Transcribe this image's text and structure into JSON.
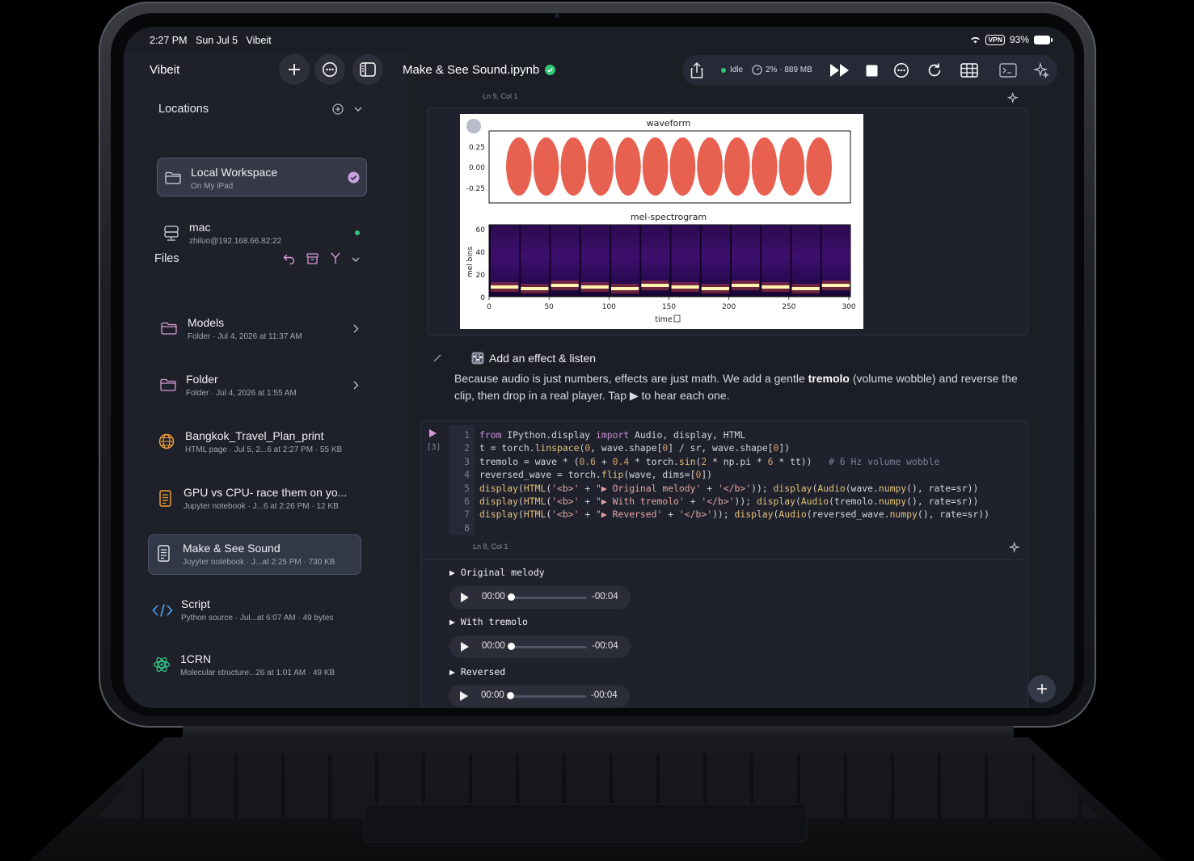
{
  "status_bar": {
    "time": "2:27 PM",
    "date": "Sun Jul 5",
    "app": "Vibeit",
    "vpn": "VPN",
    "battery": "93%"
  },
  "sidebar": {
    "app_name": "Vibeit",
    "locations_header": "Locations",
    "locations": [
      {
        "title": "Local Workspace",
        "subtitle": "On My iPad",
        "icon": "folder-icon",
        "status": "selected"
      },
      {
        "title": "mac",
        "subtitle": "zhiluo@192.168.66.82:22",
        "icon": "server-icon",
        "status": "connected"
      }
    ],
    "files_header": "Files",
    "files": [
      {
        "title": "Models",
        "subtitle": "Folder · Jul 4, 2026 at 11:37 AM",
        "icon": "folder-icon"
      },
      {
        "title": "Folder",
        "subtitle": "Folder · Jul 4, 2026 at 1:55 AM",
        "icon": "folder-icon"
      },
      {
        "title": "Bangkok_Travel_Plan_print",
        "subtitle": "HTML page · Jul 5, 2...6 at 2:27 PM · 55 KB",
        "icon": "globe-icon"
      },
      {
        "title": "GPU vs CPU- race them on yo...",
        "subtitle": "Jupyter notebook · J...6 at 2:26 PM · 12 KB",
        "icon": "notebook-icon"
      },
      {
        "title": "Make & See Sound",
        "subtitle": "Juyyter notebook · J...at 2:25 PM · 730 KB",
        "icon": "notebook-icon"
      },
      {
        "title": "Script",
        "subtitle": "Python source · Jul...at 6:07 AM · 49 bytes",
        "icon": "code-icon"
      },
      {
        "title": "1CRN",
        "subtitle": "Molecular structure...26 at 1:01 AM · 49 KB",
        "icon": "atom-icon"
      }
    ]
  },
  "toolbar": {
    "notebook_title": "Make & See Sound.ipynb",
    "kernel_status": "Idle",
    "resources": "2% · 889 MB"
  },
  "notebook": {
    "cell1_footer": "Ln 9, Col 1",
    "plot": {
      "top_title": "waveform",
      "top_yticks": [
        "0.25",
        "0.00",
        "-0.25"
      ],
      "bottom_title": "mel-spectrogram",
      "bottom_ylabel": "mel bins",
      "bottom_yticks": [
        "60",
        "40",
        "20",
        "0"
      ],
      "xticks": [
        "0",
        "50",
        "100",
        "150",
        "200",
        "250",
        "300"
      ],
      "xlabel": "time"
    },
    "markdown": {
      "title": "Add an effect & listen",
      "body_1": "Because audio is just numbers, effects are just math. We add a gentle ",
      "body_bold": "tremolo",
      "body_2": " (volume wobble) and reverse the clip, then drop in a real player. Tap ▶ to hear each one."
    },
    "code_cell": {
      "exec_count": "[3]",
      "footer": "Ln 8, Col 1",
      "line_numbers": "1\n2\n3\n4\n5\n6\n7\n8"
    },
    "outputs": [
      {
        "label": "▶ Original melody",
        "current": "00:00",
        "remaining": "-00:04",
        "progress": 0.0
      },
      {
        "label": "▶ With tremolo",
        "current": "00:00",
        "remaining": "-00:04",
        "progress": 0.0
      },
      {
        "label": "▶ Reversed",
        "current": "00:00",
        "remaining": "-00:04",
        "progress": 0.0
      }
    ]
  },
  "colors": {
    "accent_green": "#2fc774",
    "waveform": "#e8604f",
    "selected_check": "#c9a2e0"
  }
}
